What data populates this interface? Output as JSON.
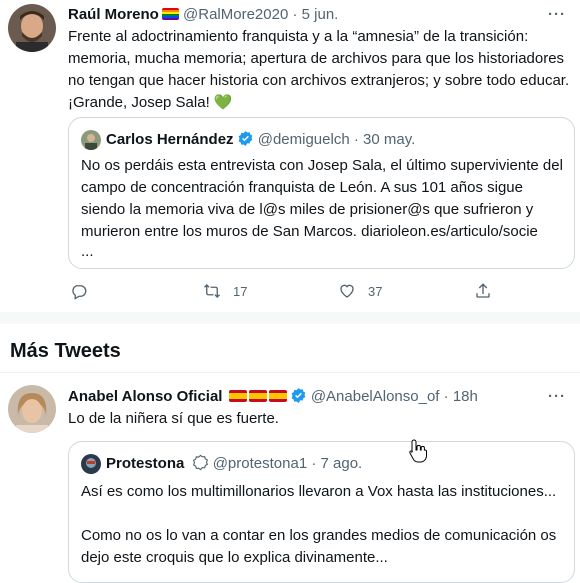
{
  "tweet1": {
    "author_name": "Raúl Moreno",
    "handle": "@RalMore2020",
    "sep": "·",
    "date": "5 jun.",
    "more": "···",
    "text_lines": [
      "Frente al adoctrinamiento franquista y a la “amnesia” de la transición:",
      "memoria, mucha memoria; apertura de archivos para que los historiadores",
      "no tengan que hacer historia con archivos extranjeros; y sobre todo educar.",
      "¡Grande, Josep Sala!"
    ],
    "heart_emoji": "💚",
    "quote": {
      "author_name": "Carlos Hernández",
      "handle": "@demiguelch",
      "sep": "·",
      "date": "30 may.",
      "text_lines": [
        "No os perdáis esta entrevista con Josep Sala, el último superviviente del",
        "campo de concentración franquista de León. A sus 101 años sigue",
        "siendo la memoria viva de l@s miles de prisioner@s que sufrieron y",
        "murieron entre los muros de San Marcos. diarioleon.es/articulo/socie",
        "..."
      ]
    },
    "actions": {
      "reply_count": "",
      "retweet_count": "17",
      "like_count": "37"
    }
  },
  "section": {
    "title": "Más Tweets"
  },
  "tweet2": {
    "author_name": "Anabel Alonso Oficial",
    "handle": "@AnabelAlonso_of",
    "sep": "·",
    "date": "18h",
    "more": "···",
    "text": "Lo de la niñera sí  que es fuerte.",
    "quote": {
      "author_name": "Protestona",
      "handle": "@protestona1",
      "sep": "·",
      "date": "7 ago.",
      "text_lines": [
        "Así es como los multimillonarios llevaron a Vox hasta las instituciones...",
        "",
        "Como no os lo van a contar en los grandes medios de comunicación os",
        "dejo este croquis que lo explica divinamente..."
      ]
    }
  },
  "colors": {
    "accent": "#1d9bf0",
    "muted": "#536471",
    "border": "#cfd9de"
  }
}
